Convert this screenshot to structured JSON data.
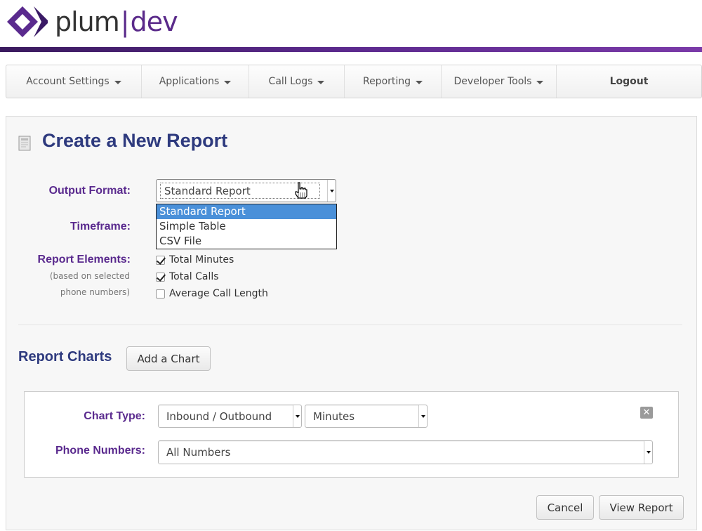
{
  "brand": {
    "name_left": "plum",
    "separator": "|",
    "name_right": "dev",
    "colors": {
      "purple": "#5a2a8e",
      "navy": "#2e3a7e"
    }
  },
  "nav": {
    "items": [
      {
        "label": "Account Settings"
      },
      {
        "label": "Applications"
      },
      {
        "label": "Call Logs"
      },
      {
        "label": "Reporting"
      },
      {
        "label": "Developer Tools"
      }
    ],
    "logout": "Logout"
  },
  "page": {
    "title": "Create a New Report",
    "icon": "document-icon"
  },
  "form": {
    "output_format": {
      "label": "Output Format:",
      "value": "Standard Report",
      "options": [
        "Standard Report",
        "Simple Table",
        "CSV File"
      ]
    },
    "timeframe": {
      "label": "Timeframe:"
    },
    "report_elements": {
      "label": "Report Elements:",
      "sublabel_1": "(based on selected",
      "sublabel_2": "phone numbers)",
      "items": [
        {
          "label": "Total Minutes",
          "checked": true
        },
        {
          "label": "Total Calls",
          "checked": true
        },
        {
          "label": "Average Call Length",
          "checked": false
        }
      ]
    }
  },
  "charts": {
    "title": "Report Charts",
    "add_button": "Add a Chart",
    "chart_type_label": "Chart Type:",
    "chart_type_value": "Inbound / Outbound",
    "metric_value": "Minutes",
    "phone_numbers_label": "Phone Numbers:",
    "phone_numbers_value": "All Numbers",
    "remove_glyph": "✕"
  },
  "actions": {
    "cancel": "Cancel",
    "view_report": "View Report"
  }
}
